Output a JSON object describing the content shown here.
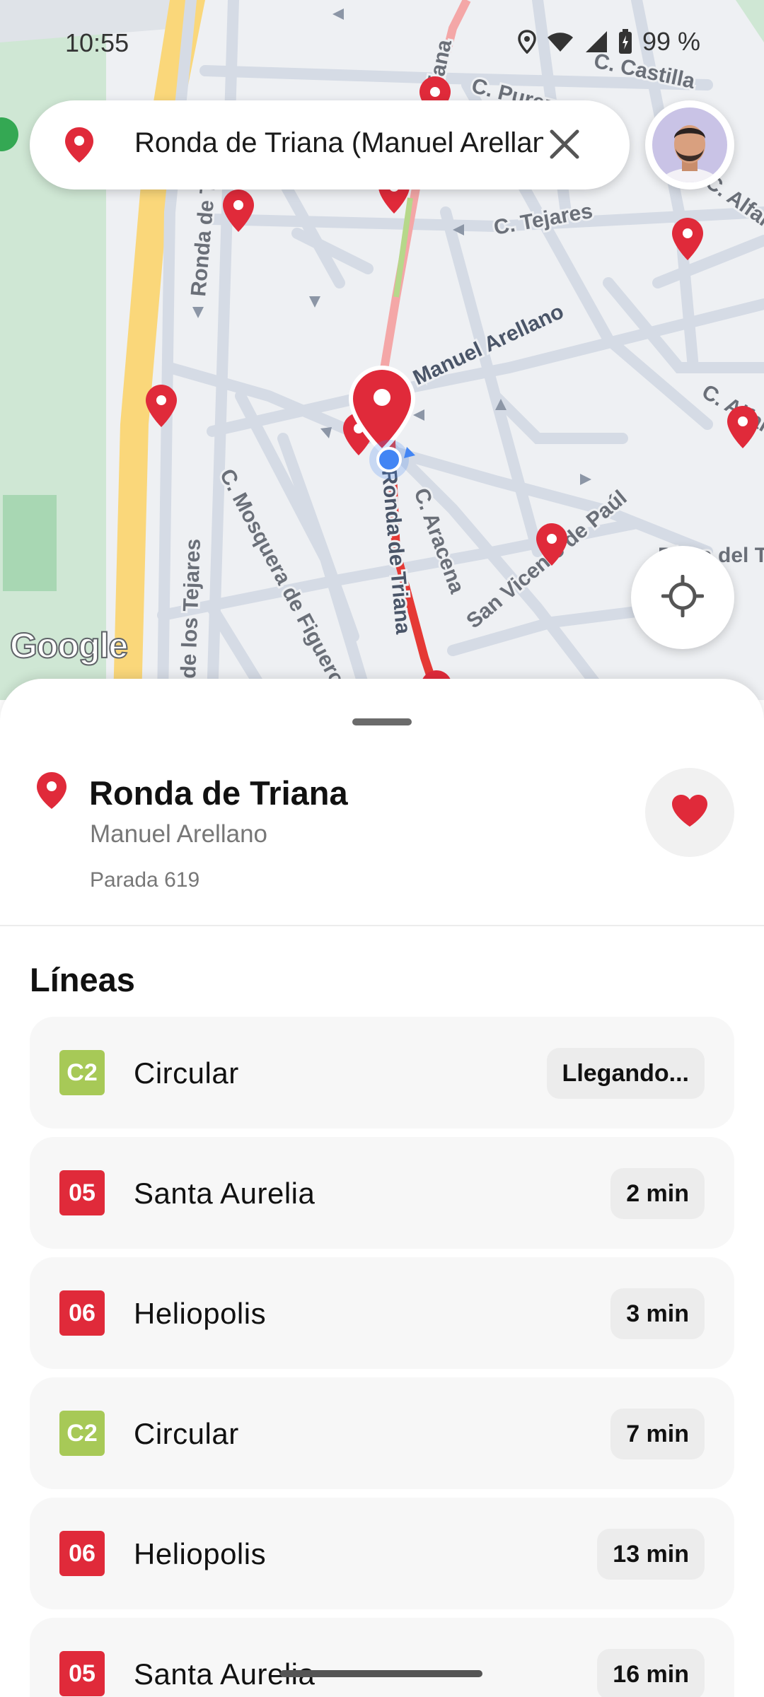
{
  "status_bar": {
    "time": "10:55",
    "battery": "99 %"
  },
  "search": {
    "value": "Ronda de Triana (Manuel Arellano)",
    "icon": "location-pin-icon",
    "clear_icon": "close-icon"
  },
  "map": {
    "provider_logo": "Google",
    "street_labels": [
      "C. Castilla",
      "C. Tejares",
      "C. Alfarería",
      "Manuel Arellano",
      "C. Mosquera de Figueroa",
      "C. Aracena",
      "San Vicente de Paúl",
      "Ronda de Triana",
      "de los Tejares",
      "Ronda de Triana",
      "C. Pureza",
      "Triana",
      "C. Alfarería",
      "Plaza del Tirol"
    ],
    "colors": {
      "background": "#eef0f3",
      "road": "#d5dbe5",
      "park": "#cfe7d4",
      "highway": "#fad77a",
      "traffic_red": "#e53935",
      "traffic_green": "#8bc34a",
      "stop_pin": "#e02a3a",
      "my_location": "#4285f4"
    }
  },
  "stop": {
    "title": "Ronda de Triana",
    "subtitle": "Manuel Arellano",
    "number": "Parada 619",
    "favorite": true
  },
  "lines_section": {
    "heading": "Líneas",
    "items": [
      {
        "code": "C2",
        "color": "#a7c957",
        "name": "Circular",
        "eta": "Llegando..."
      },
      {
        "code": "05",
        "color": "#e02a3a",
        "name": "Santa Aurelia",
        "eta": "2 min"
      },
      {
        "code": "06",
        "color": "#e02a3a",
        "name": "Heliopolis",
        "eta": "3 min"
      },
      {
        "code": "C2",
        "color": "#a7c957",
        "name": "Circular",
        "eta": "7 min"
      },
      {
        "code": "06",
        "color": "#e02a3a",
        "name": "Heliopolis",
        "eta": "13 min"
      },
      {
        "code": "05",
        "color": "#e02a3a",
        "name": "Santa Aurelia",
        "eta": "16 min"
      }
    ]
  }
}
